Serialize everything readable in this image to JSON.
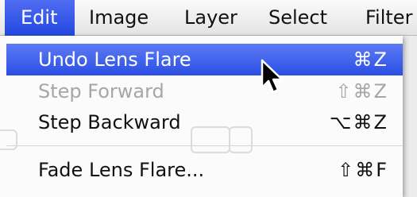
{
  "menubar": {
    "items": [
      "Edit",
      "Image",
      "Layer",
      "Select",
      "Filter"
    ]
  },
  "menu": {
    "items": [
      {
        "label": "Undo Lens Flare",
        "shortcut": "⌘Z"
      },
      {
        "label": "Step Forward",
        "shortcut": "⇧⌘Z"
      },
      {
        "label": "Step Backward",
        "shortcut": "⌥⌘Z"
      },
      {
        "label": "Fade Lens Flare...",
        "shortcut": "⇧⌘F"
      }
    ]
  },
  "colors": {
    "highlight": "#3558ea",
    "disabled_text": "#a6a6a6",
    "menu_background": "#fbfbfb"
  },
  "icons": {
    "cursor": "arrow-cursor-icon"
  }
}
